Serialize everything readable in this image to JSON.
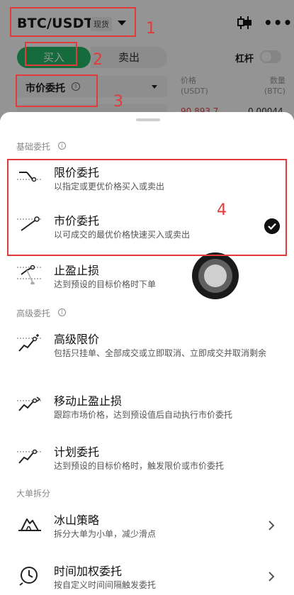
{
  "header": {
    "pair": "BTC/USDT",
    "spot_badge": "现货",
    "kline_icon": "candlestick-chart-icon",
    "more_icon": "more-dots-icon"
  },
  "trade": {
    "buy_label": "买入",
    "sell_label": "卖出",
    "leverage_label": "杠杆",
    "leverage_on": false,
    "order_type": "市价委托"
  },
  "orderbook": {
    "price_header": "价格",
    "price_unit": "(USDT)",
    "qty_header": "数量",
    "qty_unit": "(BTC)",
    "first_price": "90,893.7",
    "first_qty": "0.00044"
  },
  "annotations": [
    "1",
    "2",
    "3",
    "4"
  ],
  "sheet": {
    "basic_title": "基础委托",
    "advanced_title": "高级委托",
    "split_title": "大单拆分",
    "basic_items": [
      {
        "icon": "limit-order-icon",
        "title": "限价委托",
        "desc": "以指定或更优价格买入或卖出"
      },
      {
        "icon": "market-order-icon",
        "title": "市价委托",
        "desc": "以可成交的最优价格快速买入或卖出",
        "selected": true
      },
      {
        "icon": "take-profit-stop-loss-icon",
        "title": "止盈止损",
        "desc": "达到预设的目标价格时下单"
      }
    ],
    "advanced_items": [
      {
        "icon": "advanced-limit-icon",
        "title": "高级限价",
        "desc": "包括只挂单、全部成交或立即取消、立即成交并取消剩余"
      },
      {
        "icon": "trailing-stop-icon",
        "title": "移动止盈止损",
        "desc": "跟踪市场价格，达到预设值后自动执行市价委托"
      },
      {
        "icon": "trigger-order-icon",
        "title": "计划委托",
        "desc": "达到预设的目标价格时，触发限价或市价委托"
      }
    ],
    "split_items": [
      {
        "icon": "iceberg-icon",
        "title": "冰山策略",
        "desc": "拆分大单为小单，减少滑点"
      },
      {
        "icon": "clock-icon",
        "title": "时间加权委托",
        "desc": "按自定义时间间隔触发委托"
      }
    ]
  },
  "colors": {
    "buy_green": "#27b86a",
    "annotation_red": "#e23b3b",
    "ask_red": "#e0484e"
  }
}
